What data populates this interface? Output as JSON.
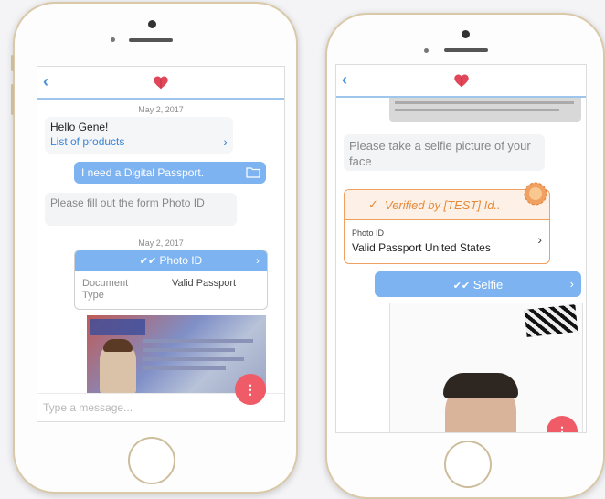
{
  "left": {
    "date1": "May 2, 2017",
    "greeting": "Hello Gene!",
    "products_link": "List of products",
    "products_chevron": "›",
    "user_msg": "I need a Digital Passport.",
    "bot_msg": "Please fill out the form Photo ID",
    "date2": "May 2, 2017",
    "card_title": "Photo ID",
    "card_chevron": "›",
    "doc_label": "Document Type",
    "doc_value": "Valid Passport",
    "input_placeholder": "Type a message...",
    "fab_label": "⋮",
    "back": "‹"
  },
  "right": {
    "back": "‹",
    "bot_msg": "Please take a selfie picture of your face",
    "verified": "Verified by [TEST] Id..",
    "photo_id_label": "Photo ID",
    "photo_id_value": "Valid Passport United States",
    "card_chevron": "›",
    "selfie_title": "Selfie",
    "selfie_chevron": "›",
    "fab_label": "⋮"
  },
  "colors": {
    "accent_blue": "#7cb3f0",
    "fab_red": "#ef5b67",
    "verified_orange": "#f0a060",
    "phone_gold": "#d9c9a8"
  }
}
